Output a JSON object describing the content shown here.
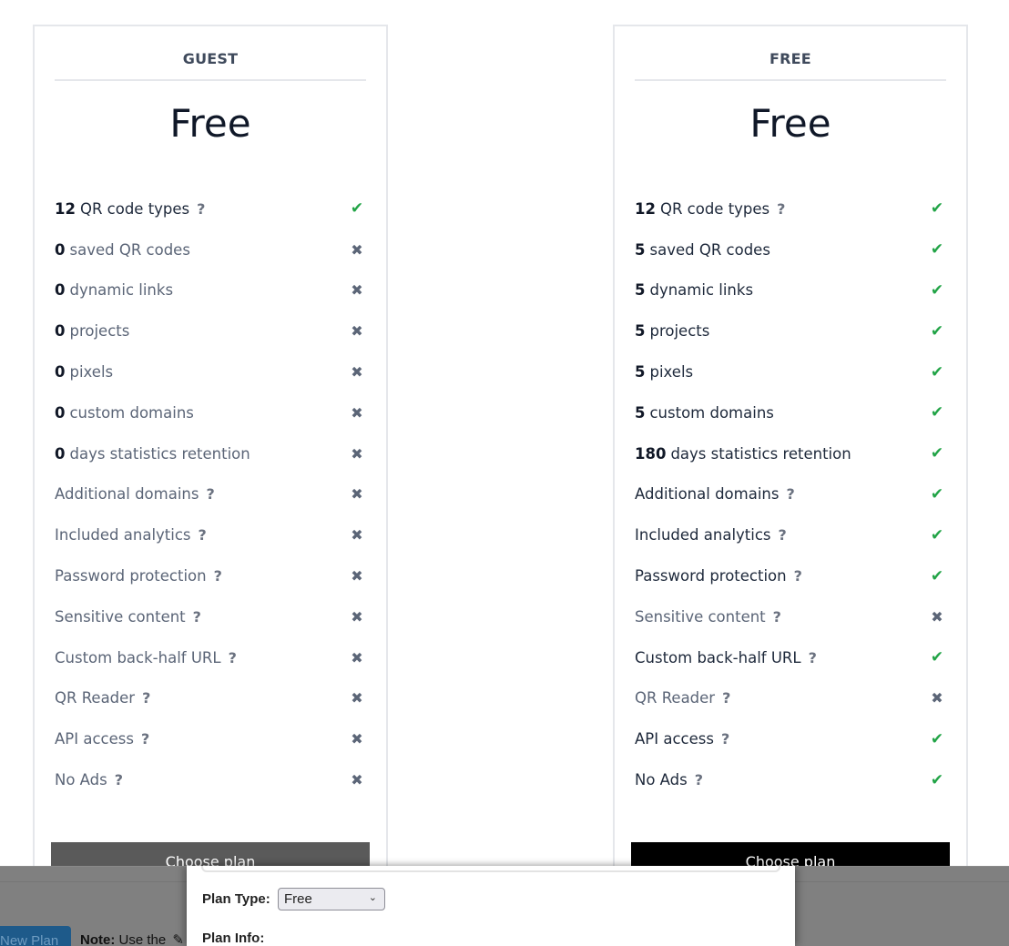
{
  "plans": [
    {
      "name": "GUEST",
      "price": "Free",
      "button_label": "Choose plan",
      "features": [
        {
          "num": "12",
          "text": "QR code types",
          "help": true,
          "included": true
        },
        {
          "num": "0",
          "text": "saved QR codes",
          "help": false,
          "included": false
        },
        {
          "num": "0",
          "text": "dynamic links",
          "help": false,
          "included": false
        },
        {
          "num": "0",
          "text": "projects",
          "help": false,
          "included": false
        },
        {
          "num": "0",
          "text": "pixels",
          "help": false,
          "included": false
        },
        {
          "num": "0",
          "text": "custom domains",
          "help": false,
          "included": false
        },
        {
          "num": "0",
          "text": "days statistics retention",
          "help": false,
          "included": false
        },
        {
          "num": "",
          "text": "Additional domains",
          "help": true,
          "included": false
        },
        {
          "num": "",
          "text": "Included analytics",
          "help": true,
          "included": false
        },
        {
          "num": "",
          "text": "Password protection",
          "help": true,
          "included": false
        },
        {
          "num": "",
          "text": "Sensitive content",
          "help": true,
          "included": false
        },
        {
          "num": "",
          "text": "Custom back-half URL",
          "help": true,
          "included": false
        },
        {
          "num": "",
          "text": "QR Reader",
          "help": true,
          "included": false
        },
        {
          "num": "",
          "text": "API access",
          "help": true,
          "included": false
        },
        {
          "num": "",
          "text": "No Ads",
          "help": true,
          "included": false
        }
      ]
    },
    {
      "name": "FREE",
      "price": "Free",
      "button_label": "Choose plan",
      "features": [
        {
          "num": "12",
          "text": "QR code types",
          "help": true,
          "included": true
        },
        {
          "num": "5",
          "text": "saved QR codes",
          "help": false,
          "included": true
        },
        {
          "num": "5",
          "text": "dynamic links",
          "help": false,
          "included": true
        },
        {
          "num": "5",
          "text": "projects",
          "help": false,
          "included": true
        },
        {
          "num": "5",
          "text": "pixels",
          "help": false,
          "included": true
        },
        {
          "num": "5",
          "text": "custom domains",
          "help": false,
          "included": true
        },
        {
          "num": "180",
          "text": "days statistics retention",
          "help": false,
          "included": true
        },
        {
          "num": "",
          "text": "Additional domains",
          "help": true,
          "included": true
        },
        {
          "num": "",
          "text": "Included analytics",
          "help": true,
          "included": true
        },
        {
          "num": "",
          "text": "Password protection",
          "help": true,
          "included": true
        },
        {
          "num": "",
          "text": "Sensitive content",
          "help": true,
          "included": false
        },
        {
          "num": "",
          "text": "Custom back-half URL",
          "help": true,
          "included": true
        },
        {
          "num": "",
          "text": "QR Reader",
          "help": true,
          "included": false
        },
        {
          "num": "",
          "text": "API access",
          "help": true,
          "included": true
        },
        {
          "num": "",
          "text": "No Ads",
          "help": true,
          "included": true
        }
      ]
    }
  ],
  "icons": {
    "help": "?",
    "check": "✔",
    "cross": "✖",
    "chevron": "⌄",
    "pencil": "✎"
  },
  "colors": {
    "check": "#22a447",
    "cross": "#5b6577",
    "guest_button": "#5a5a5a",
    "free_button": "#000000",
    "new_plan_button": "#1e5a8a"
  },
  "admin": {
    "new_plan_label": "New Plan",
    "note_bold": "Note:",
    "note_text": "Use the"
  },
  "modal": {
    "plan_type_label": "Plan Type:",
    "plan_type_value": "Free",
    "plan_info_label": "Plan Info:"
  }
}
